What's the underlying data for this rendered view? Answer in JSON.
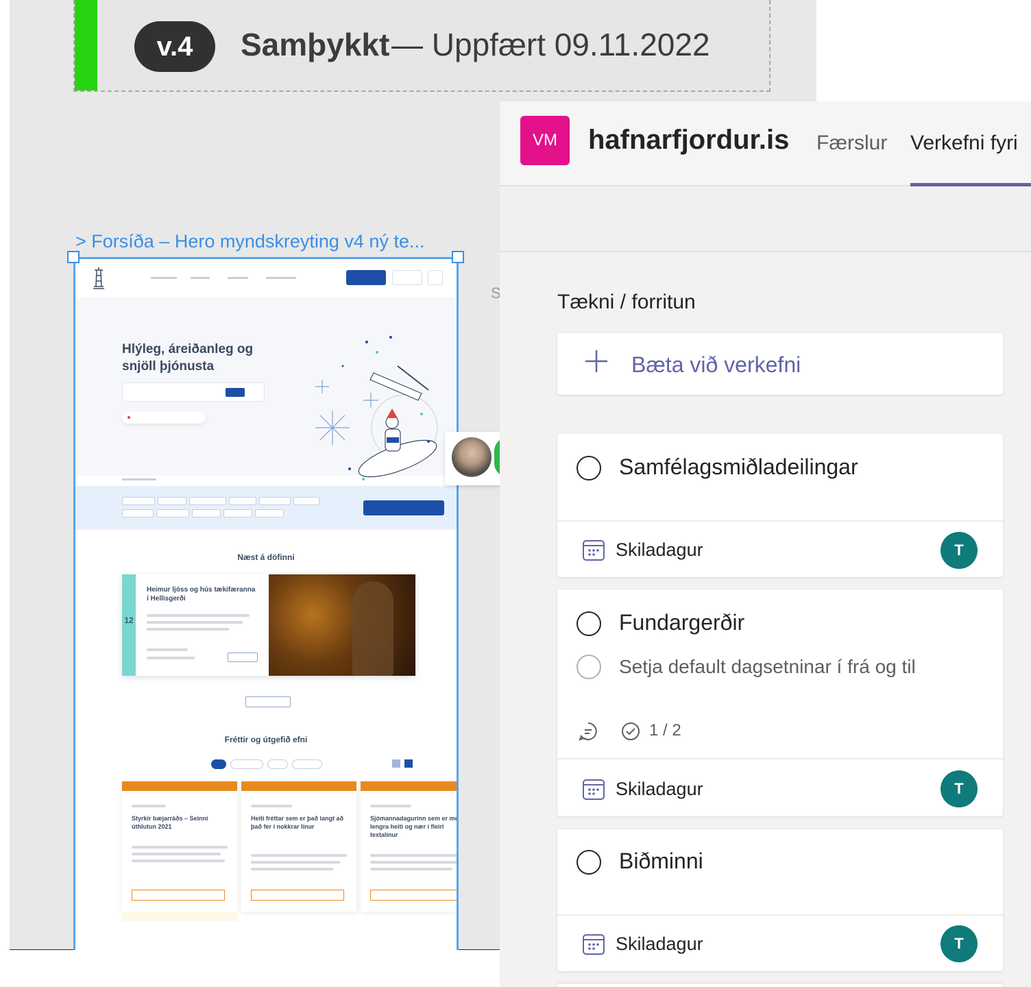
{
  "version_banner": {
    "version": "v.4",
    "status": "Samþykkt",
    "updated": "— Uppfært 09.11.2022",
    "accent_color": "#27d40f"
  },
  "design_frame": {
    "label": "> Forsíða – Hero myndskreyting v4 ný te...",
    "stray_letter": "S",
    "hero_title": "Hlýleg, áreiðanleg og snjöll þjónusta",
    "upcoming_title": "Næst á döfinni",
    "event": {
      "date": "12",
      "title": "Heimur ljóss og hús tækifæranna í Hellisgerði"
    },
    "news_title": "Fréttir og útgefið efni",
    "news_items": [
      {
        "title": "Styrkir bæjarráðs – Seinni úthlutun 2021"
      },
      {
        "title": "Heiti fréttar sem er það langt að það fer í nokkrar línur"
      },
      {
        "title": "Sjómannadagurinn sem er með lengra heiti og nær í fleiri textalínur"
      }
    ]
  },
  "planner": {
    "badge": "VM",
    "badge_color": "#e3128a",
    "team_title": "hafnarfjordur.is",
    "tabs": [
      {
        "label": "Færslur",
        "active": false
      },
      {
        "label": "Verkefni fyri",
        "active": true
      }
    ],
    "accent_color": "#6264a7",
    "bucket": {
      "title": "Tækni / forritun",
      "add_task_label": "Bæta við verkefni"
    },
    "tasks": [
      {
        "title": "Samfélagsmiðladeilingar",
        "due_label": "Skiladagur",
        "assignee_initial": "T"
      },
      {
        "title": "Fundargerðir",
        "subtask": "Setja default dagsetninar í frá og til",
        "checklist_count": "1 / 2",
        "due_label": "Skiladagur",
        "assignee_initial": "T"
      },
      {
        "title": "Biðminni",
        "due_label": "Skiladagur",
        "assignee_initial": "T"
      }
    ],
    "assignee_color": "#0f7b7b"
  }
}
